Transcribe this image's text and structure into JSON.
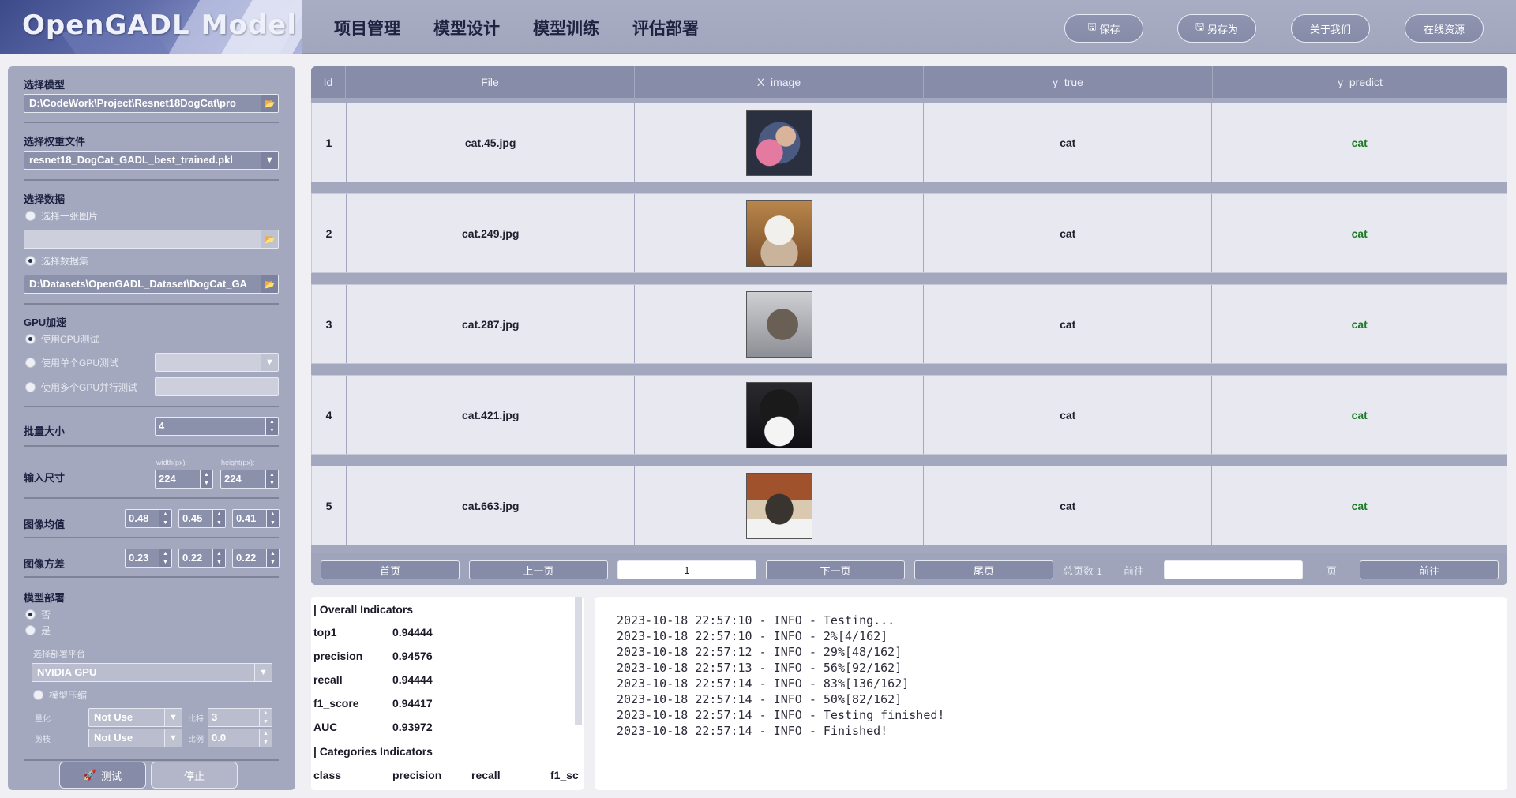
{
  "app": {
    "logo_primary": "OpenGADL",
    "logo_secondary": "Model"
  },
  "topnav": [
    "项目管理",
    "模型设计",
    "模型训练",
    "评估部署"
  ],
  "top_buttons": {
    "save": "保存",
    "save_as": "另存为",
    "about": "关于我们",
    "online": "在线资源"
  },
  "left": {
    "model_title": "选择模型",
    "model_path": "D:\\CodeWork\\Project\\Resnet18DogCat\\pro",
    "weight_title": "选择权重文件",
    "weight_file": "resnet18_DogCat_GADL_best_trained.pkl",
    "data_title": "选择数据",
    "data_opt_image": "选择一张图片",
    "data_image_path": "",
    "data_opt_dataset": "选择数据集",
    "dataset_path": "D:\\Datasets\\OpenGADL_Dataset\\DogCat_GA",
    "gpu_title": "GPU加速",
    "gpu_cpu": "使用CPU测试",
    "gpu_single": "使用单个GPU测试",
    "gpu_single_value": "",
    "gpu_multi": "使用多个GPU并行测试",
    "gpu_multi_value": "",
    "batch_label": "批量大小",
    "batch_value": "4",
    "input_label": "输入尺寸",
    "width_label": "width(px):",
    "height_label": "height(px):",
    "width_value": "224",
    "height_value": "224",
    "mean_label": "图像均值",
    "mean_values": [
      "0.48",
      "0.45",
      "0.41"
    ],
    "std_label": "图像方差",
    "std_values": [
      "0.23",
      "0.22",
      "0.22"
    ],
    "deploy_title": "模型部署",
    "deploy_no": "否",
    "deploy_yes": "是",
    "platform_label": "选择部署平台",
    "platform_value": "NVIDIA GPU",
    "compress_label": "模型压缩",
    "quant_label": "量化",
    "quant_value": "Not Use",
    "quant_ratio_label": "比特",
    "quant_ratio_value": "3",
    "prune_label": "剪枝",
    "prune_value": "Not Use",
    "prune_ratio_label": "比例",
    "prune_ratio_value": "0.0",
    "test_button": "测试",
    "stop_button": "停止"
  },
  "table": {
    "headers": [
      "Id",
      "File",
      "X_image",
      "y_true",
      "y_predict"
    ],
    "rows": [
      {
        "id": "1",
        "file": "cat.45.jpg",
        "y_true": "cat",
        "y_predict": "cat"
      },
      {
        "id": "2",
        "file": "cat.249.jpg",
        "y_true": "cat",
        "y_predict": "cat"
      },
      {
        "id": "3",
        "file": "cat.287.jpg",
        "y_true": "cat",
        "y_predict": "cat"
      },
      {
        "id": "4",
        "file": "cat.421.jpg",
        "y_true": "cat",
        "y_predict": "cat"
      },
      {
        "id": "5",
        "file": "cat.663.jpg",
        "y_true": "cat",
        "y_predict": "cat"
      }
    ]
  },
  "pager": {
    "first": "首页",
    "prev": "上一页",
    "current": "1",
    "next": "下一页",
    "last": "尾页",
    "total_label": "总页数 1",
    "goto_label": "前往",
    "goto_value": "",
    "page_unit": "页",
    "goto_button": "前往"
  },
  "metrics": {
    "overall_title": "| Overall Indicators",
    "overall": [
      {
        "name": "top1",
        "value": "0.94444"
      },
      {
        "name": "precision",
        "value": "0.94576"
      },
      {
        "name": "recall",
        "value": "0.94444"
      },
      {
        "name": "f1_score",
        "value": "0.94417"
      },
      {
        "name": "AUC",
        "value": "0.93972"
      }
    ],
    "categories_title": "| Categories Indicators",
    "category_headers": [
      "class",
      "precision",
      "recall",
      "f1_sc"
    ]
  },
  "log": [
    "2023-10-18 22:57:10 - INFO - Testing...",
    "2023-10-18 22:57:10 - INFO - 2%[4/162]",
    "2023-10-18 22:57:12 - INFO - 29%[48/162]",
    "2023-10-18 22:57:13 - INFO - 56%[92/162]",
    "2023-10-18 22:57:14 - INFO - 83%[136/162]",
    "2023-10-18 22:57:14 - INFO - 50%[82/162]",
    "2023-10-18 22:57:14 - INFO - Testing finished!",
    "2023-10-18 22:57:14 - INFO - Finished!"
  ],
  "colors": {
    "panel": "#a4a8be",
    "accent_pred": "#1b7a23",
    "header_bg": "#878ca8"
  },
  "icons": {
    "save": "floppy-icon",
    "save_as": "floppy-icon",
    "test": "rocket-icon",
    "folder": "folder-icon",
    "dropdown": "chevron-down-icon"
  }
}
